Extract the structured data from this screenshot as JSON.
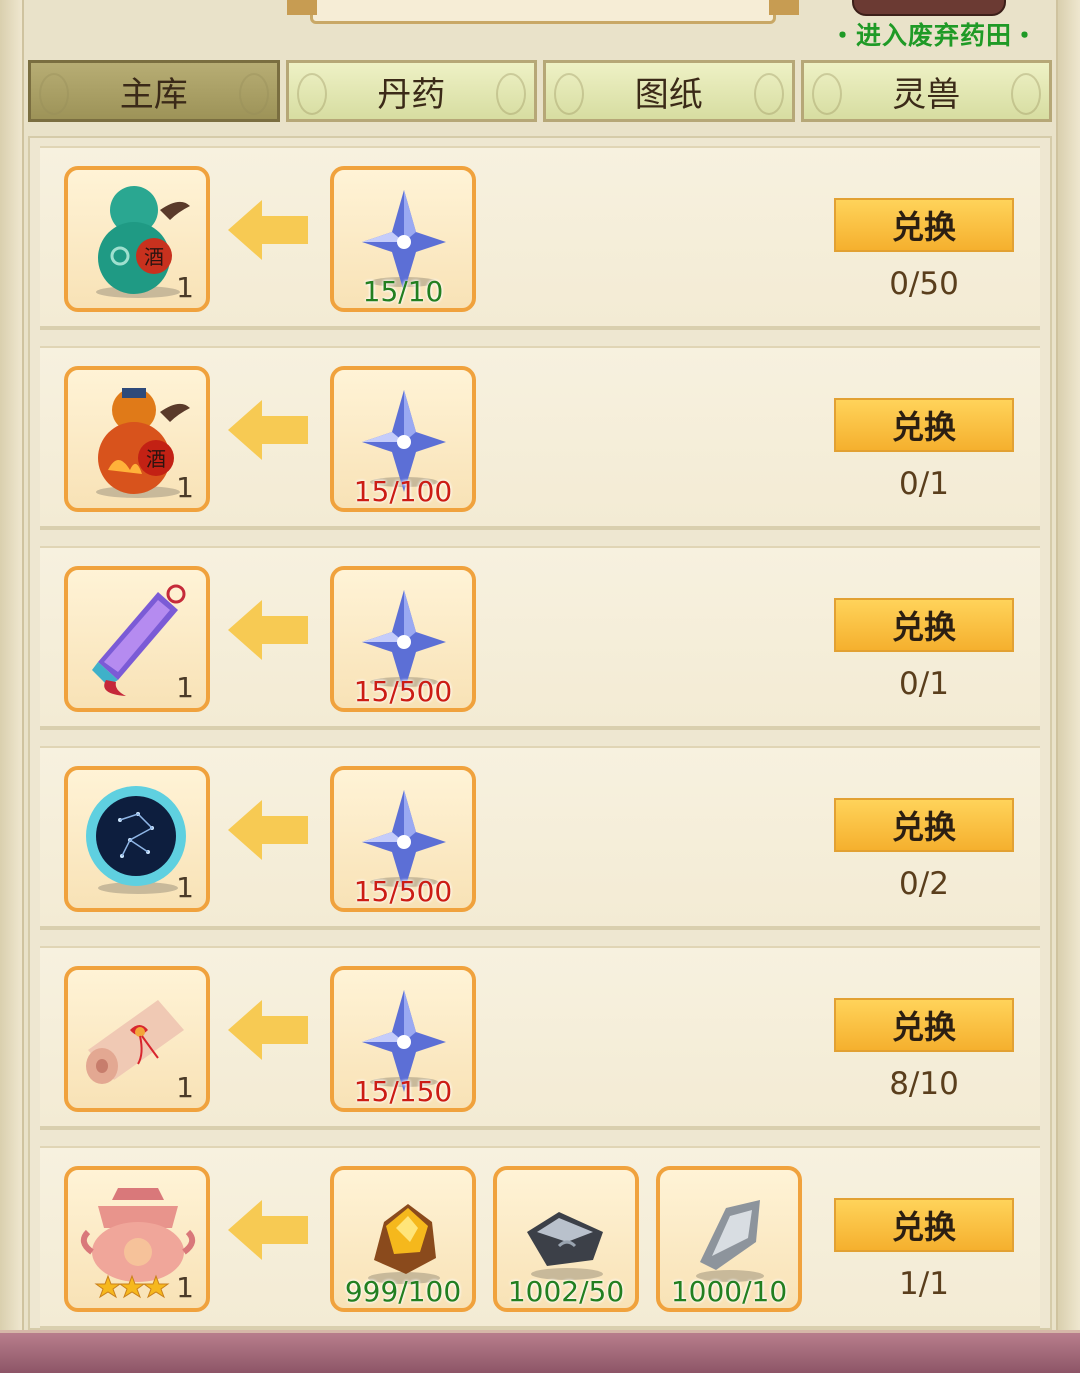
{
  "header": {
    "enter_link": "・进入废弃药田・"
  },
  "tabs": [
    {
      "label": "主库",
      "active": true
    },
    {
      "label": "丹药",
      "active": false
    },
    {
      "label": "图纸",
      "active": false
    },
    {
      "label": "灵兽",
      "active": false
    }
  ],
  "rows": [
    {
      "reward_icon": "teal-gourd-icon",
      "reward_qty": "1",
      "costs": [
        {
          "icon": "blue-star-crystal-icon",
          "count": "15/10",
          "sufficient": true
        }
      ],
      "button": "兑换",
      "progress": "0/50"
    },
    {
      "reward_icon": "red-gourd-icon",
      "reward_qty": "1",
      "costs": [
        {
          "icon": "blue-star-crystal-icon",
          "count": "15/100",
          "sufficient": false
        }
      ],
      "button": "兑换",
      "progress": "0/1"
    },
    {
      "reward_icon": "purple-talisman-icon",
      "reward_qty": "1",
      "costs": [
        {
          "icon": "blue-star-crystal-icon",
          "count": "15/500",
          "sufficient": false
        }
      ],
      "button": "兑换",
      "progress": "0/1"
    },
    {
      "reward_icon": "star-mirror-icon",
      "reward_qty": "1",
      "costs": [
        {
          "icon": "blue-star-crystal-icon",
          "count": "15/500",
          "sufficient": false
        }
      ],
      "button": "兑换",
      "progress": "0/2"
    },
    {
      "reward_icon": "scroll-icon",
      "reward_qty": "1",
      "costs": [
        {
          "icon": "blue-star-crystal-icon",
          "count": "15/150",
          "sufficient": false
        }
      ],
      "button": "兑换",
      "progress": "8/10"
    },
    {
      "reward_icon": "pink-cauldron-icon",
      "reward_qty": "1",
      "reward_stars": 3,
      "costs": [
        {
          "icon": "gold-ore-icon",
          "count": "999/100",
          "sufficient": true
        },
        {
          "icon": "dark-iron-ore-icon",
          "count": "1002/50",
          "sufficient": true
        },
        {
          "icon": "silver-ore-icon",
          "count": "1000/10",
          "sufficient": true
        }
      ],
      "button": "兑换",
      "progress": "1/1"
    }
  ],
  "colors": {
    "sufficient": "#227f20",
    "insufficient": "#cc1c14",
    "button": "#f5b02e",
    "slot_border": "#f0a23d"
  }
}
